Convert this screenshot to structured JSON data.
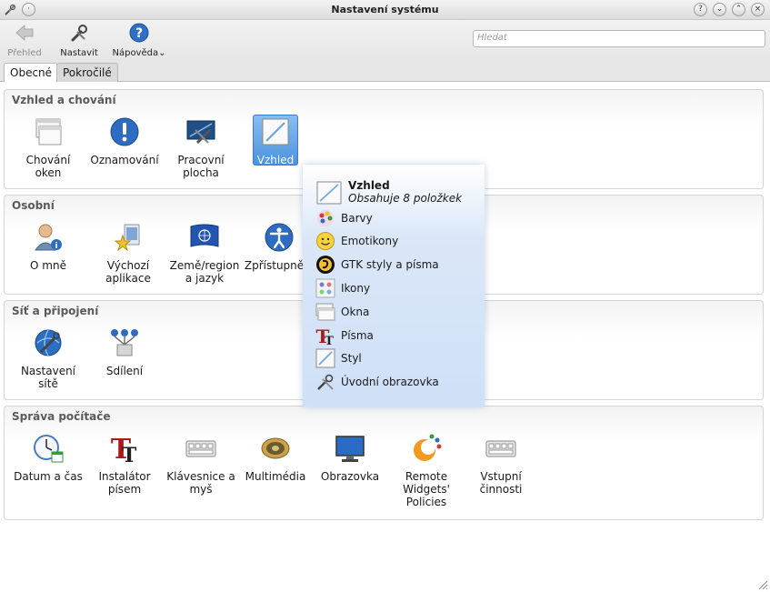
{
  "window": {
    "title": "Nastavení systému"
  },
  "toolbar": {
    "back_label": "Přehled",
    "configure_label": "Nastavit",
    "help_label": "Nápověda",
    "search_placeholder": "Hledat"
  },
  "tabs": [
    {
      "label": "Obecné",
      "active": true
    },
    {
      "label": "Pokročilé",
      "active": false
    }
  ],
  "groups": [
    {
      "title": "Vzhled a chování",
      "items": [
        {
          "label": "Chování oken",
          "icon": "window-behavior-icon"
        },
        {
          "label": "Oznamování",
          "icon": "notification-icon"
        },
        {
          "label": "Pracovní plocha",
          "icon": "desktop-icon"
        },
        {
          "label": "Vzhled",
          "icon": "appearance-icon",
          "selected": true
        }
      ]
    },
    {
      "title": "Osobní",
      "items": [
        {
          "label": "O mně",
          "icon": "user-info-icon"
        },
        {
          "label": "Výchozí aplikace",
          "icon": "default-apps-icon"
        },
        {
          "label": "Země/region a jazyk",
          "icon": "flag-icon"
        },
        {
          "label": "Zpřístupnění",
          "icon": "accessibility-icon"
        }
      ]
    },
    {
      "title": "Síť a připojení",
      "items": [
        {
          "label": "Nastavení sítě",
          "icon": "network-settings-icon"
        },
        {
          "label": "Sdílení",
          "icon": "sharing-icon"
        }
      ]
    },
    {
      "title": "Správa počítače",
      "items": [
        {
          "label": "Datum a čas",
          "icon": "clock-icon"
        },
        {
          "label": "Instalátor písem",
          "icon": "font-installer-icon"
        },
        {
          "label": "Klávesnice a myš",
          "icon": "keyboard-icon"
        },
        {
          "label": "Multimédia",
          "icon": "speaker-icon"
        },
        {
          "label": "Obrazovka",
          "icon": "monitor-icon"
        },
        {
          "label": "Remote Widgets' Policies",
          "icon": "remote-widgets-icon"
        },
        {
          "label": "Vstupní činnosti",
          "icon": "input-actions-icon"
        }
      ]
    }
  ],
  "popup": {
    "title": "Vzhled",
    "subtitle": "Obsahuje 8 položkek",
    "items": [
      {
        "label": "Barvy",
        "icon": "colors-icon"
      },
      {
        "label": "Emotikony",
        "icon": "emoticons-icon"
      },
      {
        "label": "GTK styly a písma",
        "icon": "gtk-icon"
      },
      {
        "label": "Ikony",
        "icon": "icons-icon"
      },
      {
        "label": "Okna",
        "icon": "windows-icon"
      },
      {
        "label": "Písma",
        "icon": "fonts-icon"
      },
      {
        "label": "Styl",
        "icon": "style-icon"
      },
      {
        "label": "Úvodní obrazovka",
        "icon": "splash-screen-icon"
      }
    ]
  },
  "colors": {
    "selection": "#4d93de",
    "popup_bg": "#cfe0f7",
    "group_title": "#5a5a5a"
  }
}
